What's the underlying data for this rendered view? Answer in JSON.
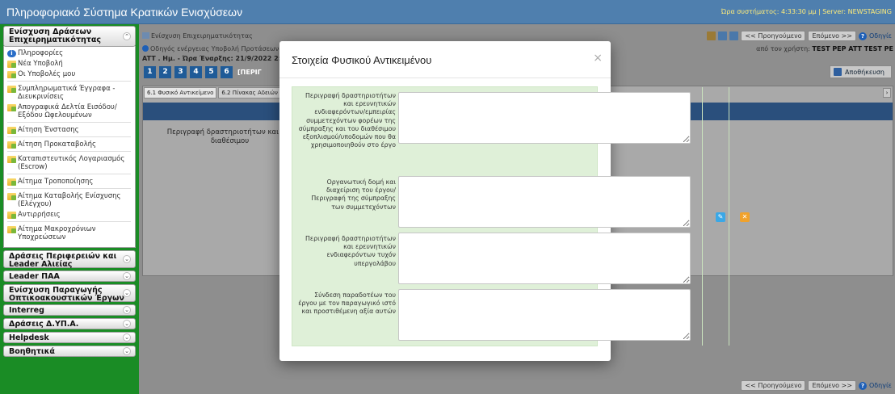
{
  "app": {
    "title": "Πληροφοριακό Σύστημα Κρατικών Ενισχύσεων",
    "system_info": "Ώρα συστήματος: 4:33:30 μμ | Server: NEWSTAGING"
  },
  "sidebar": {
    "sections": [
      {
        "title": "Ενίσχυση Δράσεων Επιχειρηματικότητας",
        "expanded": true,
        "items": [
          {
            "label": "Πληροφορίες",
            "icon": "info-icon"
          },
          {
            "label": "Νέα Υποβολή",
            "icon": "folder-icon"
          },
          {
            "label": "Οι Υποβολές μου",
            "icon": "folder-icon"
          },
          {
            "label": "Συμπληρωματικά Έγγραφα - Διευκρινίσεις",
            "icon": "folder-icon"
          },
          {
            "label": "Απογραφικά Δελτία Εισόδου/Εξόδου Ωφελουμένων",
            "icon": "folder-icon"
          },
          {
            "label": "Αίτηση Ένστασης",
            "icon": "folder-icon"
          },
          {
            "label": "Αίτηση Προκαταβολής",
            "icon": "folder-icon"
          },
          {
            "label": "Καταπιστευτικός Λογαριασμός (Escrow)",
            "icon": "folder-icon"
          },
          {
            "label": "Αίτημα Τροποποίησης",
            "icon": "folder-icon"
          },
          {
            "label": "Αίτημα Καταβολής Ενίσχυσης (Ελέγχου)",
            "icon": "folder-icon"
          },
          {
            "label": "Αντιρρήσεις",
            "icon": "folder-icon"
          },
          {
            "label": "Αίτημα Μακροχρόνιων Υποχρεώσεων",
            "icon": "folder-icon"
          }
        ]
      },
      {
        "title": "Δράσεις Περιφερειών και Leader Αλιείας",
        "expanded": false
      },
      {
        "title": "Leader ΠΑΑ",
        "expanded": false
      },
      {
        "title": "Ενίσχυση Παραγωγής Οπτικοακουστικών Έργων",
        "expanded": false
      },
      {
        "title": "Interreg",
        "expanded": false
      },
      {
        "title": "Δράσεις Δ.ΥΠ.Α.",
        "expanded": false
      },
      {
        "title": "Helpdesk",
        "expanded": false
      },
      {
        "title": "Βοηθητικά",
        "expanded": false
      }
    ]
  },
  "main": {
    "breadcrumb": "Ενίσχυση Επιχειρηματικότητας",
    "prev_label": "<< Προηγούμενο",
    "next_label": "Επόμενο >>",
    "help_label": "Οδηγίε",
    "guide_line": "Οδηγός ενέργειας Υποβολή Προτάσεων [ΗΛ",
    "info_line": "ATT . Ημ. - Ώρα Έναρξης: 21/9/2022 2:",
    "user_line_prefix": "από τον χρήστη:",
    "user_name": "TEST PEP ATT TEST PE",
    "steps": [
      "1",
      "2",
      "3",
      "4",
      "5",
      "6"
    ],
    "step_label": "[ΠΕΡΙΓ",
    "save_label": "Αποθήκευση",
    "subtabs": [
      "6.1 Φυσικό Αντικείμενο",
      "6.2 Πίνακας Αδειών"
    ],
    "column_text": "Περιγραφή δραστηριοτήτων και ερε διαθέσιμου"
  },
  "modal": {
    "title": "Στοιχεία Φυσικού Αντικειμένου",
    "close": "×",
    "fields": [
      {
        "label": "Περιγραφή δραστηριοτήτων και ερευνητικών ενδιαφερόντων/εμπειρίας συμμετεχόντων φορέων της σύμπραξης και του διαθέσιμου εξοπλισμού/υποδομών που θα χρησιμοποιηθούν στο έργο",
        "value": ""
      },
      {
        "label": "Οργανωτική δομή και διαχείριση του έργου/ Περιγραφή της σύμπραξης των συμμετεχόντων",
        "value": ""
      },
      {
        "label": "Περιγραφή δραστηριοτήτων και ερευνητικών ενδιαφερόντων τυχόν υπεργολάβου",
        "value": ""
      },
      {
        "label": "Σύνδεση παραδοτέων του έργου με τον παραγωγικό ιστό και προστιθέμενη αξία αυτών",
        "value": ""
      }
    ],
    "edit_icon": "edit-icon",
    "delete_icon": "close-icon"
  }
}
